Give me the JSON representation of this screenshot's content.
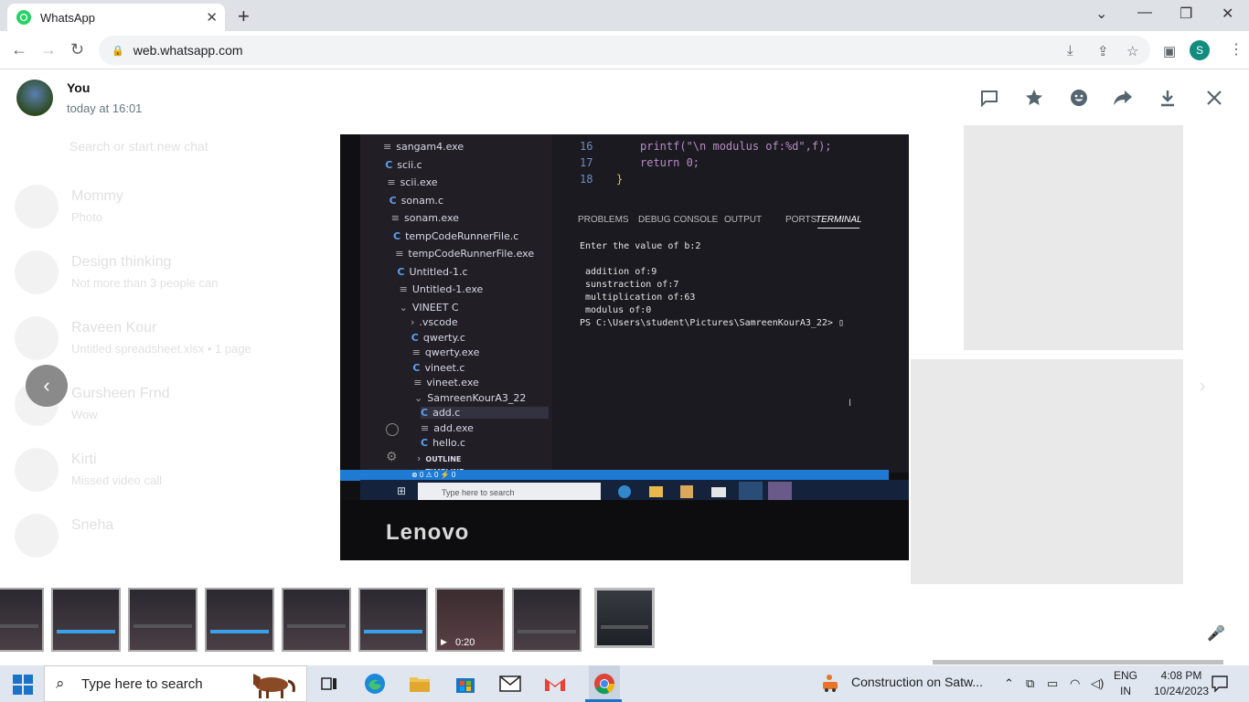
{
  "browser": {
    "tab_title": "WhatsApp",
    "url": "web.whatsapp.com",
    "profile_initial": "S"
  },
  "viewer": {
    "sender": "You",
    "timestamp": "today at 16:01",
    "icons": [
      "message-icon",
      "star-icon",
      "emoji-icon",
      "forward-icon",
      "download-icon",
      "close-icon"
    ]
  },
  "background_chats": [
    {
      "name": "Search or start new chat",
      "sub": ""
    },
    {
      "name": "Mommy",
      "sub": "Photo"
    },
    {
      "name": "Design thinking",
      "sub": "Not more than 3 people can"
    },
    {
      "name": "Raveen Kour",
      "sub": "Untitled spreadsheet.xlsx • 1 page"
    },
    {
      "name": "Gursheen Frnd",
      "sub": "Wow"
    },
    {
      "name": "Kirti",
      "sub": "Missed video call"
    },
    {
      "name": "Sneha",
      "sub": ""
    }
  ],
  "photo": {
    "files": [
      {
        "name": "sangam4.exe",
        "kind": "exe"
      },
      {
        "name": "scii.c",
        "kind": "c"
      },
      {
        "name": "scii.exe",
        "kind": "exe"
      },
      {
        "name": "sonam.c",
        "kind": "c"
      },
      {
        "name": "sonam.exe",
        "kind": "exe"
      },
      {
        "name": "tempCodeRunnerFile.c",
        "kind": "c"
      },
      {
        "name": "tempCodeRunnerFile.exe",
        "kind": "exe"
      },
      {
        "name": "Untitled-1.c",
        "kind": "c"
      },
      {
        "name": "Untitled-1.exe",
        "kind": "exe"
      },
      {
        "name": "VINEET C",
        "kind": "folder"
      },
      {
        "name": ".vscode",
        "kind": "folder-closed"
      },
      {
        "name": "qwerty.c",
        "kind": "c"
      },
      {
        "name": "qwerty.exe",
        "kind": "exe"
      },
      {
        "name": "vineet.c",
        "kind": "c"
      },
      {
        "name": "vineet.exe",
        "kind": "exe"
      },
      {
        "name": "SamreenKourA3_22",
        "kind": "folder"
      },
      {
        "name": "add.c",
        "kind": "c"
      },
      {
        "name": "add.exe",
        "kind": "exe"
      },
      {
        "name": "hello.c",
        "kind": "c"
      },
      {
        "name": "OUTLINE",
        "kind": "section"
      },
      {
        "name": "TIMELINE",
        "kind": "section"
      }
    ],
    "code_lines": [
      {
        "num": "16",
        "text": "printf(\"\\n modulus of:%d\",f);"
      },
      {
        "num": "17",
        "text": "return 0;"
      },
      {
        "num": "18",
        "text": "}"
      }
    ],
    "panel_tabs": [
      "PROBLEMS",
      "DEBUG CONSOLE",
      "OUTPUT",
      "PORTS",
      "TERMINAL"
    ],
    "terminal": "Enter the value of b:2\n\n addition of:9\n sunstraction of:7\n multiplication of:63\n modulus of:0\nPS C:\\Users\\student\\Pictures\\SamreenKourA3_22> ▯",
    "status": "⊗ 0 ⚠ 0   ⚡ 0",
    "taskbar_search": "Type here to search",
    "brand": "Lenovo"
  },
  "thumbnails": [
    {
      "kind": "image"
    },
    {
      "kind": "image"
    },
    {
      "kind": "image"
    },
    {
      "kind": "image"
    },
    {
      "kind": "image"
    },
    {
      "kind": "image"
    },
    {
      "kind": "video",
      "duration": "0:20"
    },
    {
      "kind": "image"
    },
    {
      "kind": "image",
      "selected": true
    }
  ],
  "taskbar": {
    "search_placeholder": "Type here to search",
    "notification": "Construction on Satw...",
    "language_top": "ENG",
    "language_bottom": "IN",
    "time": "4:08 PM",
    "date": "10/24/2023"
  }
}
